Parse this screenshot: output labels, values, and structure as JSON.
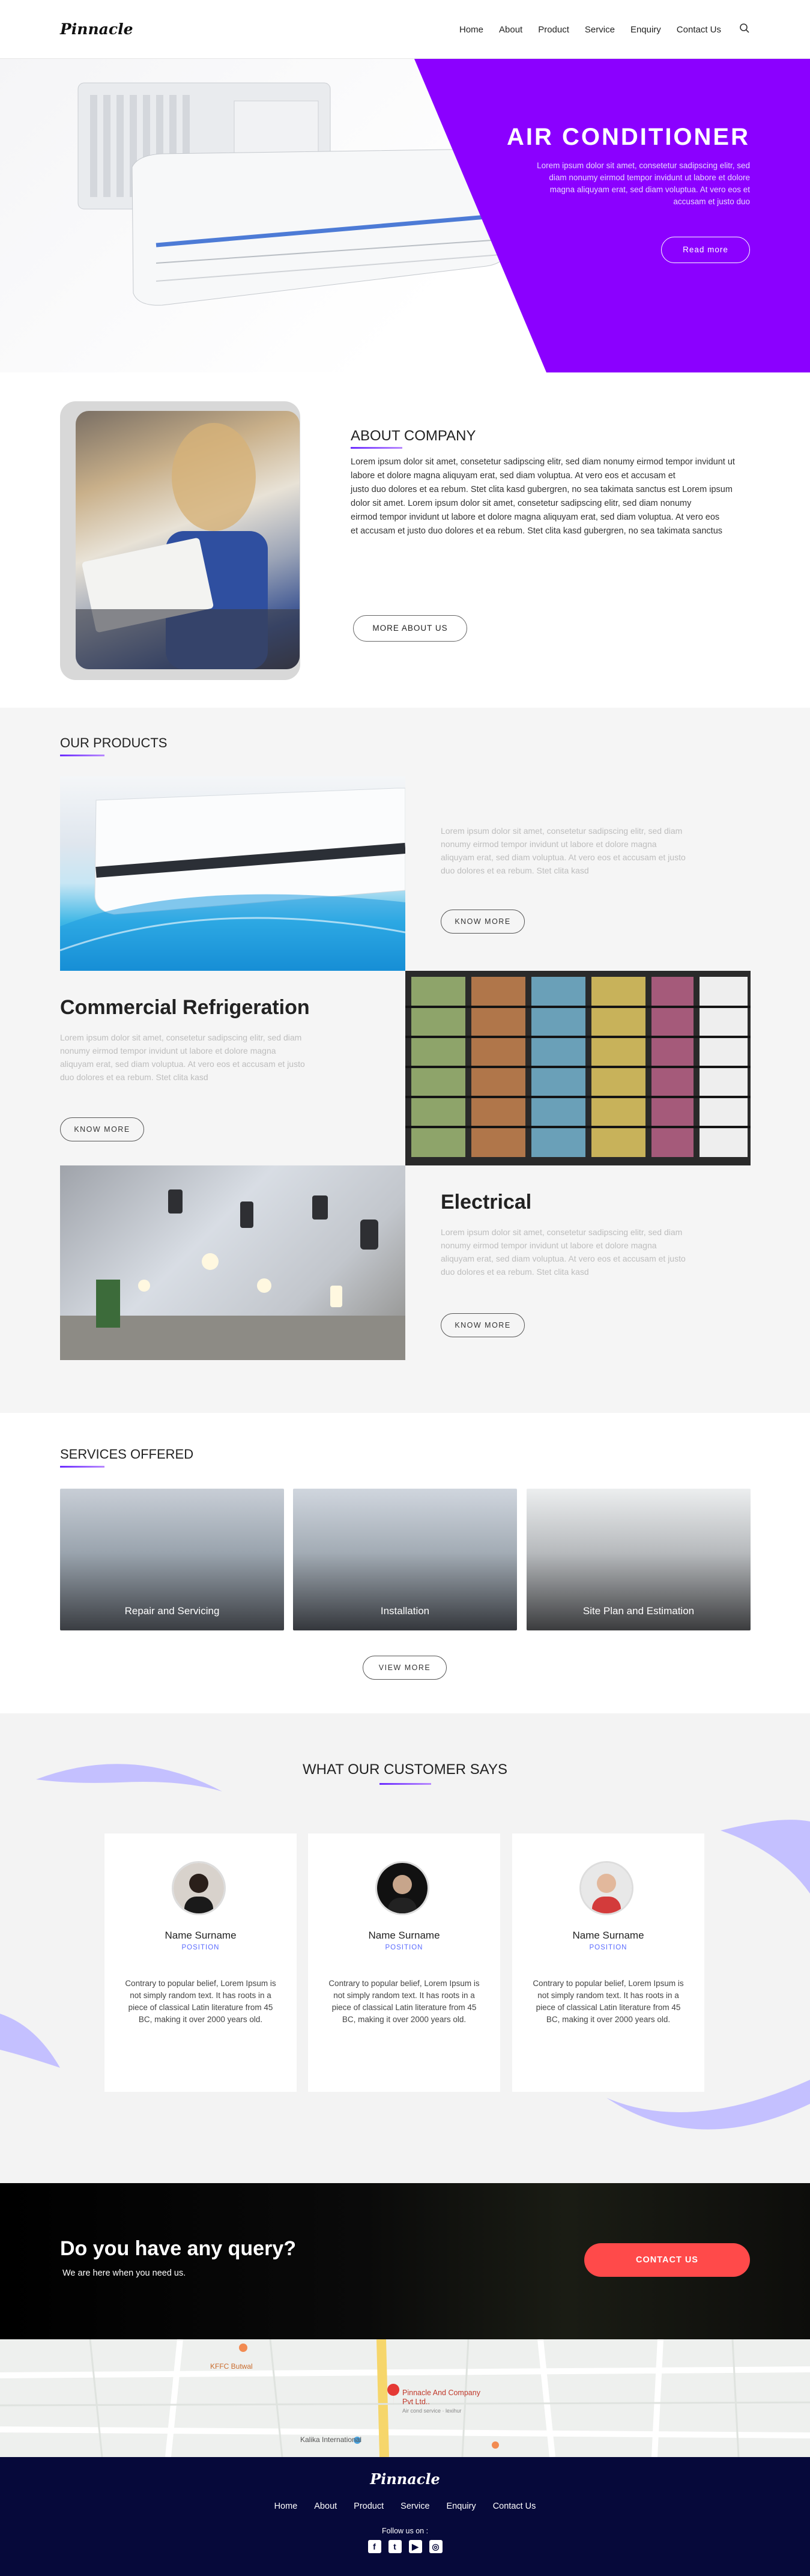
{
  "header": {
    "logo": "Pinnacle",
    "nav": [
      "Home",
      "About",
      "Product",
      "Service",
      "Enquiry",
      "Contact Us"
    ]
  },
  "hero": {
    "title": "AIR CONDITIONER",
    "text": "Lorem ipsum dolor sit amet, consetetur sadipscing elitr, sed diam nonumy eirmod tempor invidunt ut labore et dolore magna aliquyam erat, sed diam voluptua. At vero eos et accusam et justo duo",
    "button": "Read more"
  },
  "about": {
    "title": "ABOUT COMPANY",
    "paragraphs": [
      "Lorem ipsum dolor sit amet, consetetur sadipscing elitr, sed diam nonumy eirmod tempor invidunt ut labore et dolore magna aliquyam erat, sed diam voluptua. At vero eos et accusam et",
      "justo duo dolores et ea rebum. Stet clita kasd gubergren, no sea takimata sanctus est Lorem ipsum dolor sit amet. Lorem ipsum dolor sit amet, consetetur sadipscing elitr, sed diam nonumy",
      "eirmod tempor invidunt ut labore et dolore magna aliquyam erat, sed diam voluptua. At vero eos",
      "et accusam et justo duo dolores et ea rebum. Stet clita kasd gubergren, no sea takimata sanctus"
    ],
    "button": "MORE ABOUT US"
  },
  "products": {
    "title": "OUR PRODUCTS",
    "items": [
      {
        "title": "",
        "text": "Lorem ipsum dolor sit amet, consetetur sadipscing elitr, sed diam nonumy eirmod tempor invidunt ut labore et dolore magna aliquyam erat, sed diam voluptua. At vero eos et accusam et justo duo dolores et ea rebum. Stet clita kasd",
        "button": "KNOW MORE"
      },
      {
        "title": "Commercial Refrigeration",
        "text": "Lorem ipsum dolor sit amet, consetetur sadipscing elitr, sed diam nonumy eirmod tempor invidunt ut labore et dolore magna aliquyam erat, sed diam voluptua. At vero eos et accusam et justo duo dolores et ea rebum. Stet clita kasd",
        "button": "KNOW MORE"
      },
      {
        "title": "Electrical",
        "text": "Lorem ipsum dolor sit amet, consetetur sadipscing elitr, sed diam nonumy eirmod tempor invidunt ut labore et dolore magna aliquyam erat, sed diam voluptua. At vero eos et accusam et justo duo dolores et ea rebum. Stet clita kasd",
        "button": "KNOW MORE"
      }
    ]
  },
  "services": {
    "title": "SERVICES OFFERED",
    "items": [
      "Repair and Servicing",
      "Installation",
      "Site Plan and Estimation"
    ],
    "button": "VIEW MORE"
  },
  "testimonials": {
    "title": "WHAT OUR CUSTOMER SAYS",
    "cards": [
      {
        "name": "Name Surname",
        "position": "POSITION",
        "text": "Contrary to popular belief, Lorem Ipsum is not simply random text. It has roots in a piece of classical Latin literature from 45 BC, making it over 2000 years old."
      },
      {
        "name": "Name Surname",
        "position": "POSITION",
        "text": "Contrary to popular belief, Lorem Ipsum is not simply random text. It has roots in a piece of classical Latin literature from 45 BC, making it over 2000 years old."
      },
      {
        "name": "Name Surname",
        "position": "POSITION",
        "text": "Contrary to popular belief, Lorem Ipsum is not simply random text. It has roots in a piece of classical Latin literature from 45 BC, making it over 2000 years old."
      }
    ]
  },
  "query": {
    "title": "Do you have any query?",
    "subtitle": "We are here when you need us.",
    "button": "CONTACT US"
  },
  "map": {
    "labels": [
      "KFFC Butwal",
      "Pinnacle And Company Pvt Ltd..",
      "Kalika International"
    ],
    "sublabel": "Air cond service · lexihur"
  },
  "footer": {
    "logo": "Pinnacle",
    "nav": [
      "Home",
      "About",
      "Product",
      "Service",
      "Enquiry",
      "Contact Us"
    ],
    "follow": "Follow us on :",
    "social_icons": [
      "facebook-icon",
      "twitter-icon",
      "youtube-icon",
      "instagram-icon"
    ]
  },
  "colors": {
    "accent": "#8b00ff",
    "cta": "#ff4a4a",
    "footer": "#06093a"
  }
}
